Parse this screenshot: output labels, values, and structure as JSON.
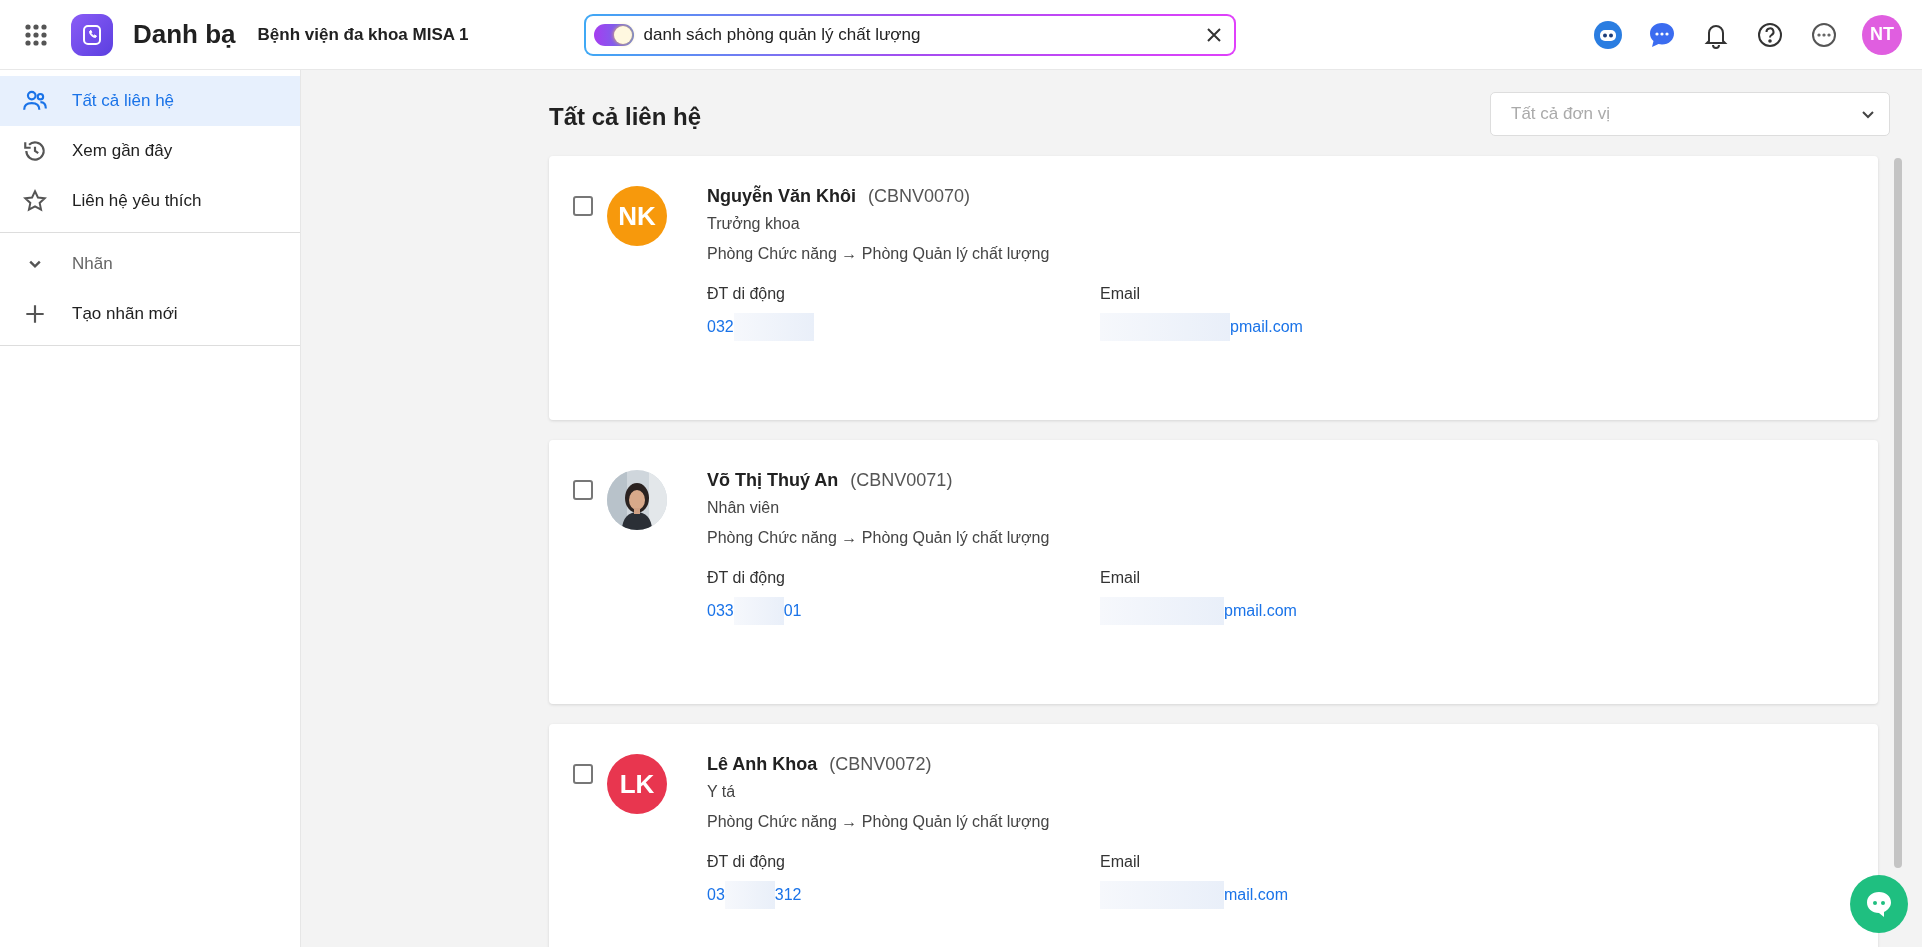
{
  "header": {
    "app_name": "Danh bạ",
    "organization": "Bệnh viện đa khoa MISA 1",
    "search": {
      "value": "danh sách phòng quản lý chất lượng",
      "ai_on": true
    },
    "avatar_initials": "NT"
  },
  "sidebar": {
    "items": [
      {
        "label": "Tất cả liên hệ",
        "selected": true
      },
      {
        "label": "Xem gần đây",
        "selected": false
      },
      {
        "label": "Liên hệ yêu thích",
        "selected": false
      }
    ],
    "labels_section": {
      "title": "Nhãn",
      "expanded": true,
      "create_label": "Tạo nhãn mới"
    }
  },
  "main": {
    "title": "Tất cả liên hệ",
    "unit_filter": {
      "placeholder": "Tất cả đơn vị"
    },
    "contacts": [
      {
        "name": "Nguyễn Văn Khôi",
        "code": "(CBNV0070)",
        "position": "Trưởng khoa",
        "department": "Phòng Chức năng → Phòng Quản lý chất lượng",
        "checked": false,
        "avatar": {
          "kind": "initials",
          "initials": "NK",
          "color": "#f7990c"
        },
        "phone_label": "ĐT di động",
        "phone_start": "032",
        "email_label": "Email",
        "email_end": "pmail.com"
      },
      {
        "name": "Võ Thị Thuý An",
        "code": "(CBNV0071)",
        "position": "Nhân viên",
        "department": "Phòng Chức năng → Phòng Quản lý chất lượng",
        "checked": false,
        "phone_label": "ĐT di động",
        "phone_start": "033",
        "phone_end": "01",
        "email_label": "Email",
        "email_end": "pmail.com"
      },
      {
        "name": "Lê Anh Khoa",
        "code": "(CBNV0072)",
        "position": "Y tá",
        "department": "Phòng Chức năng → Phòng Quản lý chất lượng",
        "checked": false,
        "avatar": {
          "kind": "initials",
          "initials": "LK",
          "color": "#e8364f"
        },
        "phone_label": "ĐT di động",
        "phone_start": "03",
        "phone_end": "312",
        "email_label": "Email",
        "email_end": "mail.com"
      }
    ]
  }
}
